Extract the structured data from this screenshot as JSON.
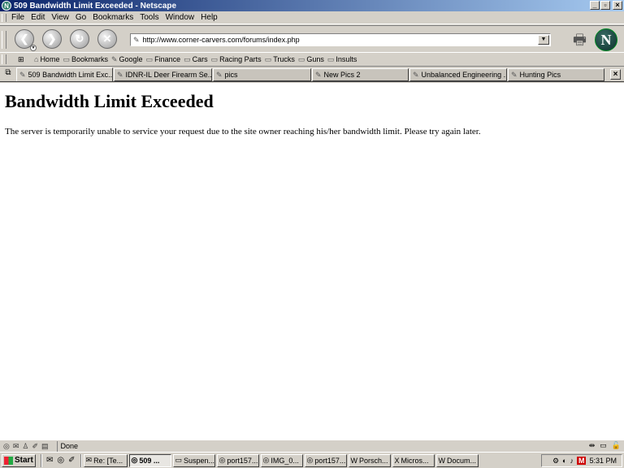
{
  "window": {
    "title": "509 Bandwidth Limit Exceeded - Netscape"
  },
  "menu": [
    "File",
    "Edit",
    "View",
    "Go",
    "Bookmarks",
    "Tools",
    "Window",
    "Help"
  ],
  "nav": {
    "url": "http://www.corner-carvers.com/forums/index.php"
  },
  "personal_toolbar": [
    "Home",
    "Bookmarks",
    "Google",
    "Finance",
    "Cars",
    "Racing Parts",
    "Trucks",
    "Guns",
    "Insults"
  ],
  "tabs": [
    "509 Bandwidth Limit Exc...",
    "IDNR-IL Deer Firearm Se...",
    "pics",
    "New Pics 2",
    "Unbalanced Engineering ...",
    "Hunting Pics"
  ],
  "page": {
    "heading": "Bandwidth Limit Exceeded",
    "message": "The server is temporarily unable to service your request due to the site owner reaching his/her bandwidth limit. Please try again later."
  },
  "status": {
    "text": "Done"
  },
  "taskbar": {
    "start": "Start",
    "tasks": [
      "Re: [Te...",
      "509 ...",
      "Suspen...",
      "port157...",
      "IMG_0...",
      "port157...",
      "Porsch...",
      "Micros...",
      "Docum..."
    ],
    "clock": "5:31 PM"
  }
}
